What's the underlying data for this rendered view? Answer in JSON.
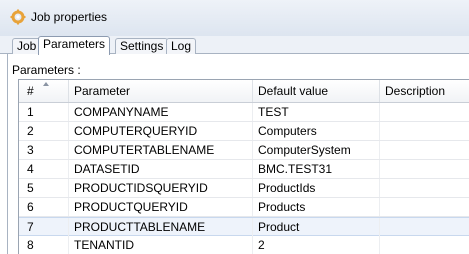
{
  "window": {
    "title": "Job properties"
  },
  "tabs": [
    {
      "label": "Job",
      "active": false
    },
    {
      "label": "Parameters",
      "active": true
    },
    {
      "label": "Settings",
      "active": false
    },
    {
      "label": "Log",
      "active": false
    }
  ],
  "panel": {
    "label": "Parameters :"
  },
  "table": {
    "columns": [
      "#",
      "Parameter",
      "Default value",
      "Description"
    ],
    "rows": [
      {
        "num": "1",
        "parameter": "COMPANYNAME",
        "default": "TEST",
        "description": ""
      },
      {
        "num": "2",
        "parameter": "COMPUTERQUERYID",
        "default": "Computers",
        "description": ""
      },
      {
        "num": "3",
        "parameter": "COMPUTERTABLENAME",
        "default": "ComputerSystem",
        "description": ""
      },
      {
        "num": "4",
        "parameter": "DATASETID",
        "default": "BMC.TEST31",
        "description": ""
      },
      {
        "num": "5",
        "parameter": "PRODUCTIDSQUERYID",
        "default": "ProductIds",
        "description": ""
      },
      {
        "num": "6",
        "parameter": "PRODUCTQUERYID",
        "default": "Products",
        "description": ""
      },
      {
        "num": "7",
        "parameter": "PRODUCTTABLENAME",
        "default": "Product",
        "description": "",
        "selected": true
      },
      {
        "num": "8",
        "parameter": "TENANTID",
        "default": "2",
        "description": ""
      }
    ]
  },
  "colors": {
    "selection": "#eef3fb",
    "border": "#a8b3c2",
    "titlebar": "#dde5f0"
  },
  "icons": {
    "title": "gears-icon",
    "sort": "sort-ascending-icon"
  }
}
